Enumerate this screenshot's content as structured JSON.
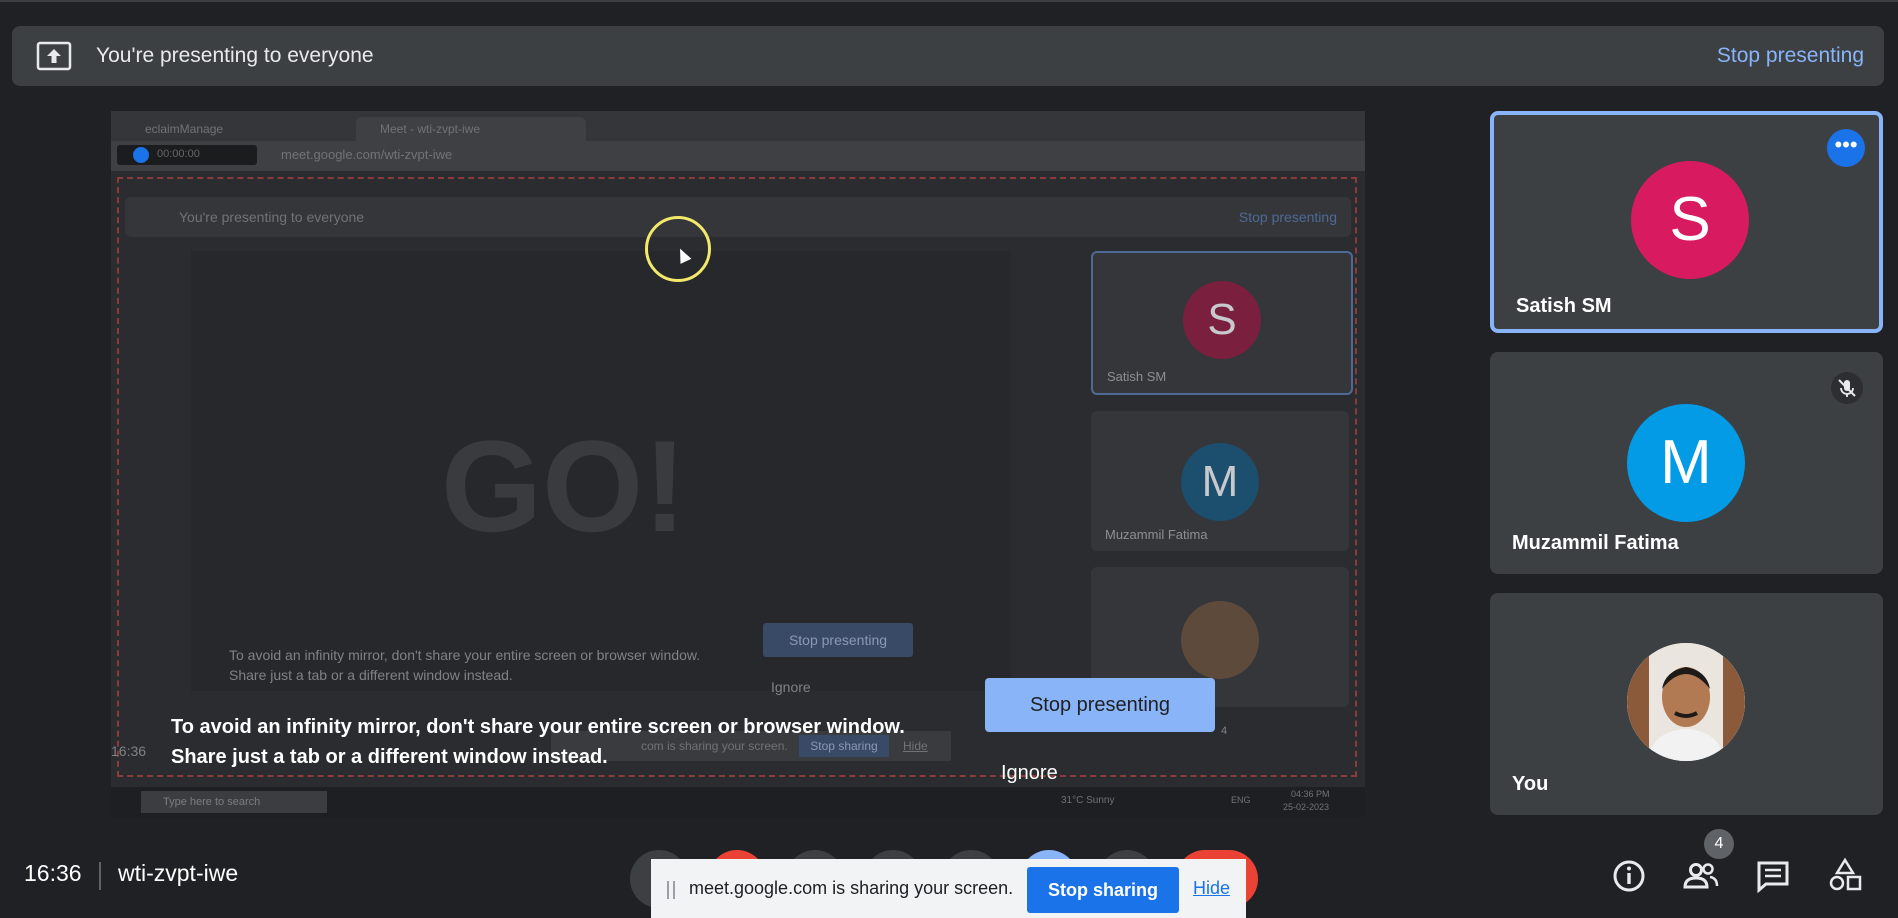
{
  "present_bar": {
    "label": "You're presenting to everyone",
    "stop_label": "Stop presenting"
  },
  "shared_screen": {
    "tabs": [
      "eclaimManage",
      "Meet - wti-zvpt-iwe"
    ],
    "url": "meet.google.com/wti-zvpt-iwe",
    "recording_time": "00:00:00",
    "inner_present_label": "You're presenting to everyone",
    "inner_stop_label": "Stop presenting",
    "go_text": "GO!",
    "inner_tiles": [
      "Satish SM",
      "Muzammil Fatima"
    ],
    "inner_warning_1": "To avoid an infinity mirror, don't share your entire screen or browser window.",
    "inner_warning_2": "Share just a tab or a different window instead.",
    "inner_ignore": "Ignore",
    "inner_share_msg": "com is sharing your screen.",
    "inner_stop_sharing": "Stop sharing",
    "inner_hide": "Hide",
    "inner_time": "16:36",
    "taskbar_search": "Type here to search",
    "weather": "31°C Sunny",
    "tray_time": "04:36 PM",
    "tray_date": "25-02-2023",
    "lang": "ENG",
    "inner_badge": "4"
  },
  "mirror_warning": {
    "line1": "To avoid an infinity mirror, don't share your entire screen or browser window.",
    "line2": "Share just a tab or a different window instead.",
    "stop_button": "Stop presenting",
    "ignore": "Ignore"
  },
  "participants": [
    {
      "name": "Satish SM",
      "initial": "S",
      "color": "#d81b60"
    },
    {
      "name": "Muzammil Fatima",
      "initial": "M",
      "color": "#039be5"
    },
    {
      "name": "You",
      "initial": "",
      "color": "#c79a70"
    }
  ],
  "bottom": {
    "time": "16:36",
    "meeting_code": "wti-zvpt-iwe",
    "people_count": "4"
  },
  "share_banner": {
    "message": "meet.google.com is sharing your screen.",
    "stop_label": "Stop sharing",
    "hide_label": "Hide"
  },
  "icons": {
    "present": "present-to-all-icon",
    "more": "more-options-icon",
    "mic_off": "mic-off-icon",
    "info": "info-icon",
    "people": "people-icon",
    "chat": "chat-icon",
    "activities": "activities-icon"
  },
  "colors": {
    "accent": "#8ab4f8",
    "primary_blue": "#1a73e8",
    "danger": "#ea4335",
    "background": "#202124",
    "surface": "#3c4043"
  }
}
